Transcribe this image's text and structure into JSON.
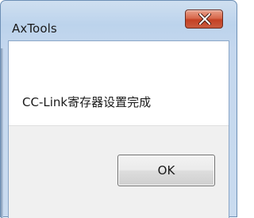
{
  "window": {
    "title": "AxTools",
    "close_icon": "close-x-icon"
  },
  "dialog": {
    "message": "CC-Link寄存器设置完成",
    "ok_label": "OK"
  },
  "colors": {
    "close_button": "#c94a2e",
    "frame": "#bcd3ec",
    "footer": "#f0f0f0"
  }
}
